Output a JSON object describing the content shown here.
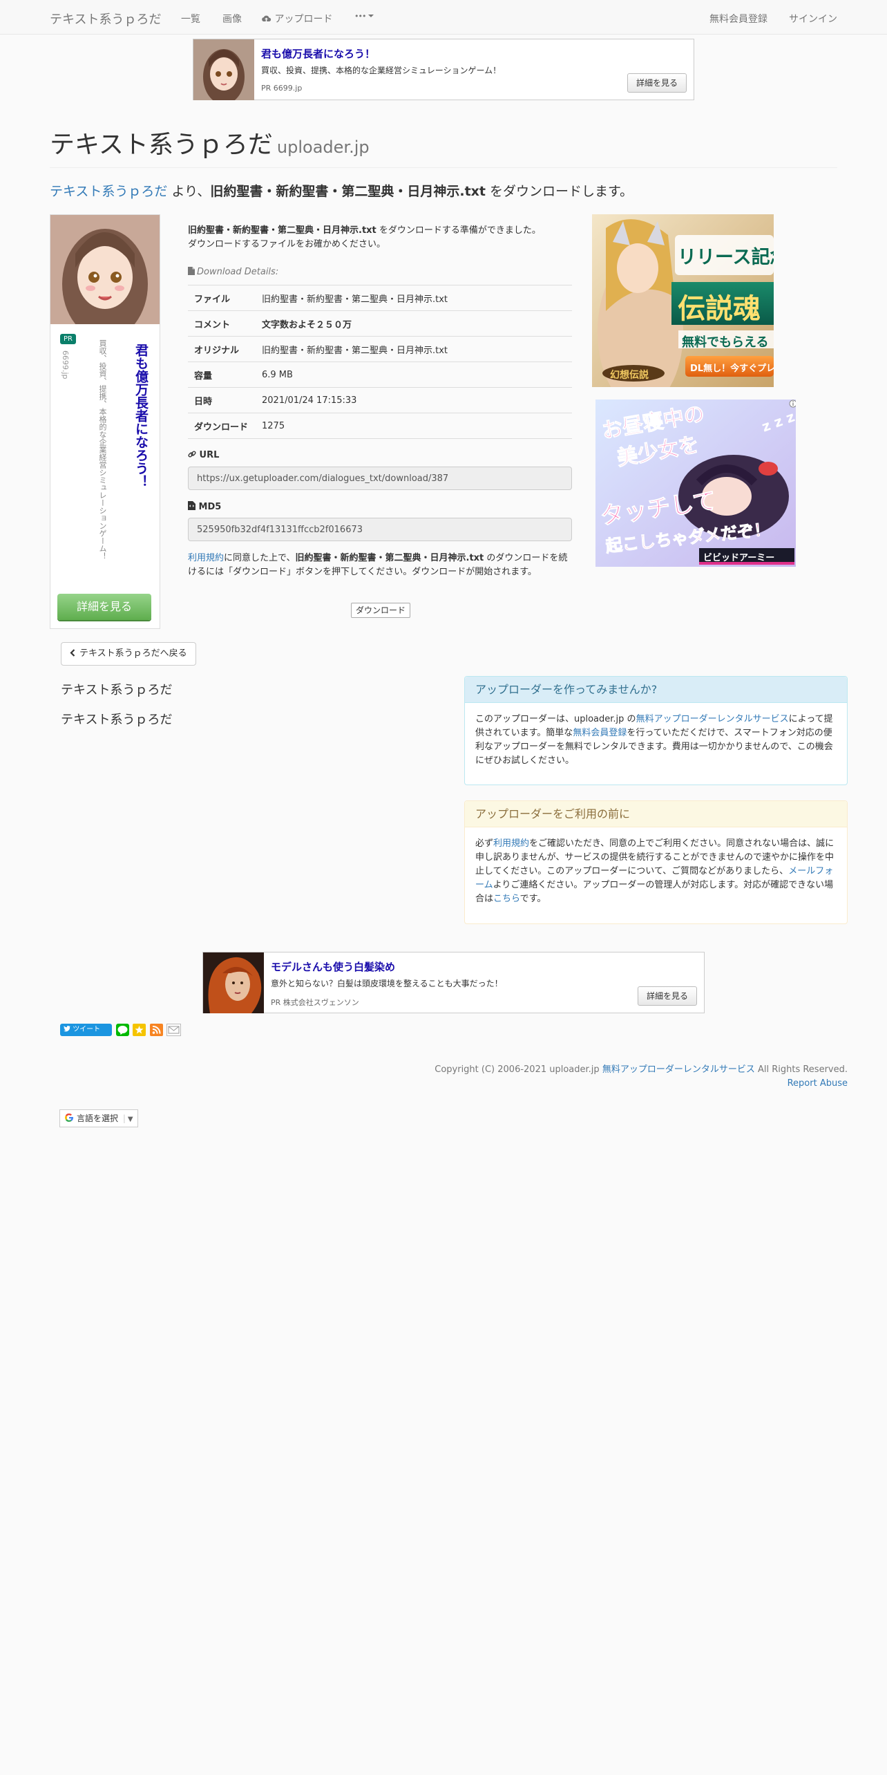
{
  "nav": {
    "brand": "テキスト系うｐろだ",
    "links": [
      "一覧",
      "画像",
      "アップロード",
      "•••"
    ],
    "right": [
      "無料会員登録",
      "サインイン"
    ]
  },
  "top_ad": {
    "title": "君も億万長者になろう！",
    "desc": "買収、投資、提携、本格的な企業経営シミュレーションゲーム！",
    "pr": "PR  6699.jp",
    "button": "詳細を見る"
  },
  "header": {
    "title": "テキスト系うｐろだ",
    "subtitle": "uploader.jp"
  },
  "lead": {
    "site": "テキスト系うｐろだ",
    "from": " より、",
    "file": "旧約聖書・新約聖書・第二聖典・日月神示.txt",
    "suffix": " をダウンロードします。"
  },
  "side_ad": {
    "pr": "PR",
    "domain": "6699.jp",
    "desc": "買収、投資、提携、本格的な企業経営シミュレーションゲーム！",
    "title": "君も億万長者になろう！",
    "button": "詳細を見る"
  },
  "intro": {
    "file": "旧約聖書・新約聖書・第二聖典・日月神示.txt",
    "text1": " をダウンロードする準備ができました。",
    "text2": "ダウンロードするファイルをお確かめください。"
  },
  "details": {
    "caption": "Download Details:",
    "rows": [
      {
        "label": "ファイル",
        "value": "旧約聖書・新約聖書・第二聖典・日月神示.txt"
      },
      {
        "label": "コメント",
        "value": "文字数およそ２５０万"
      },
      {
        "label": "オリジナル",
        "value": "旧約聖書・新約聖書・第二聖典・日月神示.txt"
      },
      {
        "label": "容量",
        "value": "6.9 MB"
      },
      {
        "label": "日時",
        "value": "2021/01/24 17:15:33"
      },
      {
        "label": "ダウンロード",
        "value": "1275"
      }
    ]
  },
  "url": {
    "label": "URL",
    "value": "https://ux.getuploader.com/dialogues_txt/download/387"
  },
  "md5": {
    "label": "MD5",
    "value": "525950fb32df4f13131ffccb2f016673"
  },
  "agree": {
    "terms": "利用規約",
    "t1": "に同意した上で、",
    "file": "旧約聖書・新約聖書・第二聖典・日月神示.txt",
    "t2": " のダウンロードを続けるには「ダウンロード」ボタンを押下してください。ダウンロードが開始されます。"
  },
  "download_button": "ダウンロード",
  "banner1": {
    "line1": "リリース記念",
    "line2": "伝説魂",
    "line3": "無料でもらえる",
    "cta": "DL無し！今すぐプレイ",
    "logo": "幻想伝説"
  },
  "banner2": {
    "line1": "お昼寝中の",
    "line2": "美少女を",
    "line3": "タッチして",
    "line4": "起こしちゃダメだぞ！",
    "logo": "ビビッドアーミー",
    "zz": "z z z"
  },
  "back_button": "テキスト系うｐろだへ戻る",
  "left_texts": [
    "テキスト系うｐろだ",
    "テキスト系うｐろだ"
  ],
  "panel_info": {
    "title": "アップローダーを作ってみませんか?",
    "p1": "このアップローダーは、uploader.jp の",
    "link1": "無料アップローダーレンタルサービス",
    "p2": "によって提供されています。簡単な",
    "link2": "無料会員登録",
    "p3": "を行っていただくだけで、スマートフォン対応の便利なアップローダーを無料でレンタルできます。費用は一切かかりませんので、この機会にぜひお試しください。"
  },
  "panel_warn": {
    "title": "アップローダーをご利用の前に",
    "p1": "必ず",
    "link1": "利用規約",
    "p2": "をご確認いただき、同意の上でご利用ください。同意されない場合は、誠に申し訳ありませんが、サービスの提供を続行することができませんので速やかに操作を中止してください。このアップローダーについて、ご質問などがありましたら、",
    "link2": "メールフォーム",
    "p3": "よりご連絡ください。アップローダーの管理人が対応します。対応が確認できない場合は",
    "link3": "こちら",
    "p4": "です。"
  },
  "bottom_ad": {
    "title": "モデルさんも使う白髪染め",
    "desc": "意外と知らない？白髪は頭皮環境を整えることも大事だった！",
    "pr": "PR  株式会社スヴェンソン",
    "button": "詳細を見る"
  },
  "share": {
    "tweet": "ツイート"
  },
  "footer": {
    "copy1": "Copyright (C) 2006-2021 uploader.jp ",
    "copy_link": "無料アップローダーレンタルサービス",
    "copy2": " All Rights Reserved.",
    "report": "Report Abuse"
  },
  "translate": {
    "label": "言語を選択",
    "arrow": "▼"
  },
  "colors": {
    "link": "#337ab7",
    "ad_title": "#1a0dab",
    "info_bg": "#d9edf7",
    "warn_bg": "#fcf8e3"
  }
}
